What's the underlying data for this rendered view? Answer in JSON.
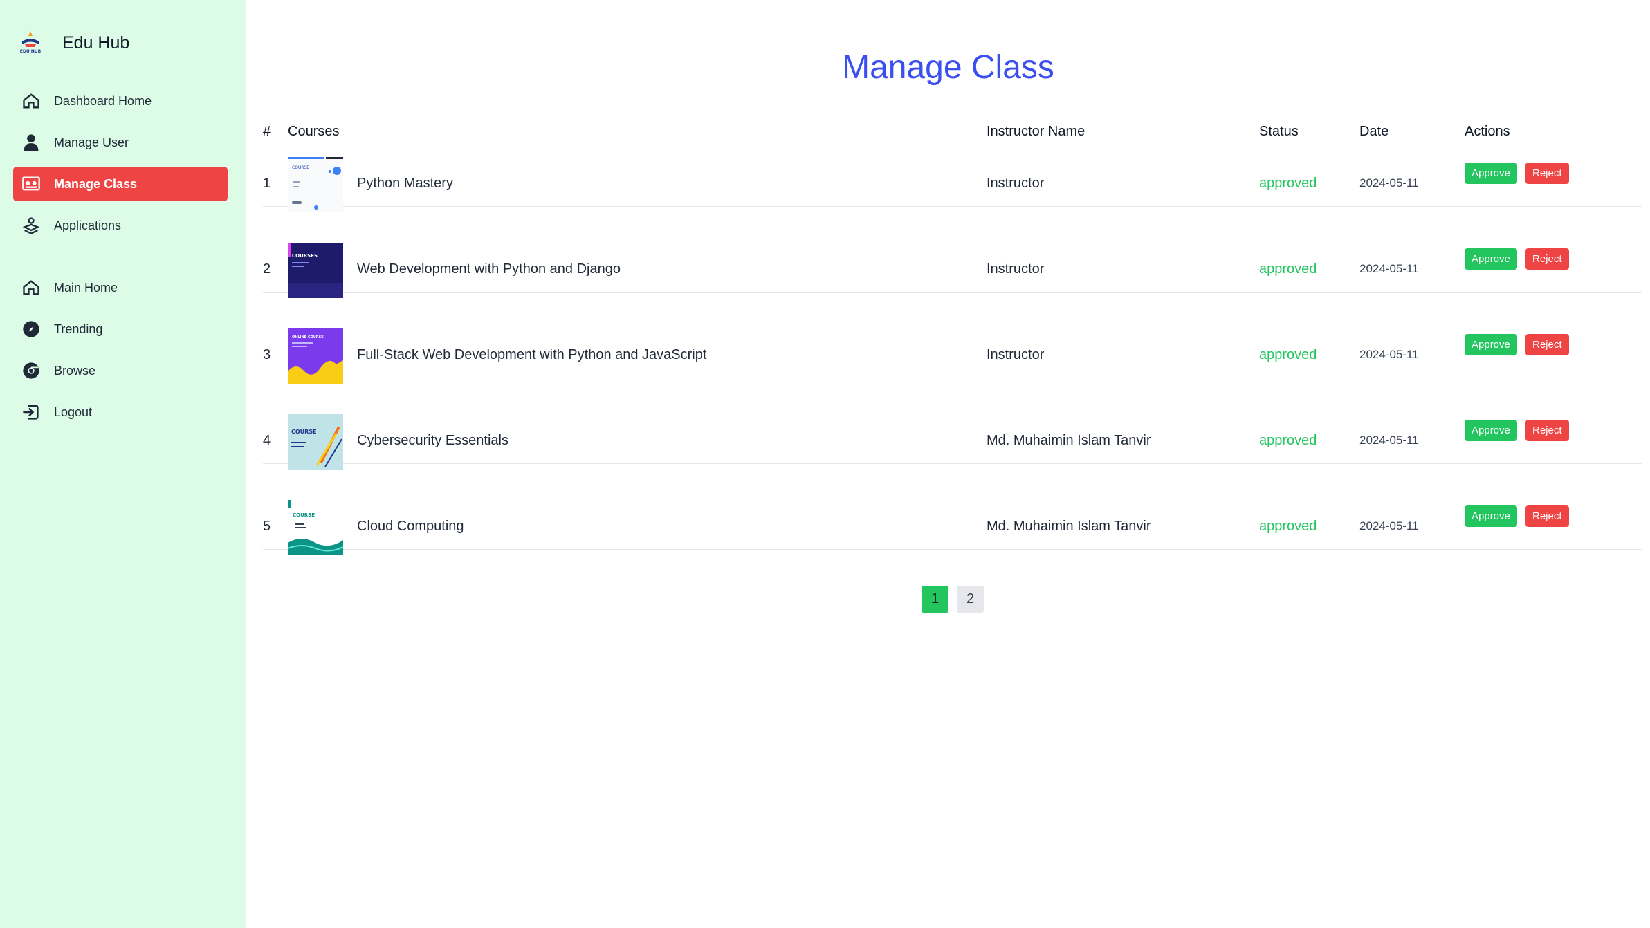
{
  "app": {
    "name": "Edu Hub",
    "logo_text": "EDU HUB"
  },
  "sidebar": {
    "dashboard_items": [
      {
        "label": "Dashboard Home",
        "icon": "home-icon",
        "active": false
      },
      {
        "label": "Manage User",
        "icon": "user-icon",
        "active": false
      },
      {
        "label": "Manage Class",
        "icon": "class-board-icon",
        "active": true
      },
      {
        "label": "Applications",
        "icon": "applications-icon",
        "active": false
      }
    ],
    "site_items": [
      {
        "label": "Main Home",
        "icon": "home-icon"
      },
      {
        "label": "Trending",
        "icon": "compass-icon"
      },
      {
        "label": "Browse",
        "icon": "browse-icon"
      },
      {
        "label": "Logout",
        "icon": "logout-icon"
      }
    ]
  },
  "page": {
    "title": "Manage Class"
  },
  "table": {
    "headers": {
      "num": "#",
      "courses": "Courses",
      "instructor": "Instructor Name",
      "status": "Status",
      "date": "Date",
      "actions": "Actions"
    },
    "rows": [
      {
        "num": "1",
        "course": "Python Mastery",
        "instructor": "Instructor",
        "status": "approved",
        "date": "2024-05-11",
        "thumb_text": "COURSE"
      },
      {
        "num": "2",
        "course": "Web Development with Python and Django",
        "instructor": "Instructor",
        "status": "approved",
        "date": "2024-05-11",
        "thumb_text": "COURSES"
      },
      {
        "num": "3",
        "course": "Full-Stack Web Development with Python and JavaScript",
        "instructor": "Instructor",
        "status": "approved",
        "date": "2024-05-11",
        "thumb_text": "ONLINE COURSE"
      },
      {
        "num": "4",
        "course": "Cybersecurity Essentials",
        "instructor": "Md. Muhaimin Islam Tanvir",
        "status": "approved",
        "date": "2024-05-11",
        "thumb_text": "COURSE"
      },
      {
        "num": "5",
        "course": "Cloud Computing",
        "instructor": "Md. Muhaimin Islam Tanvir",
        "status": "approved",
        "date": "2024-05-11",
        "thumb_text": "COURSE"
      }
    ],
    "approve_label": "Approve",
    "reject_label": "Reject"
  },
  "pagination": {
    "pages": [
      "1",
      "2"
    ],
    "current": "1"
  },
  "colors": {
    "sidebar_bg": "#dcfce7",
    "active_red": "#ef4444",
    "approve_green": "#22c55e",
    "title_blue": "#3b4ff0"
  }
}
